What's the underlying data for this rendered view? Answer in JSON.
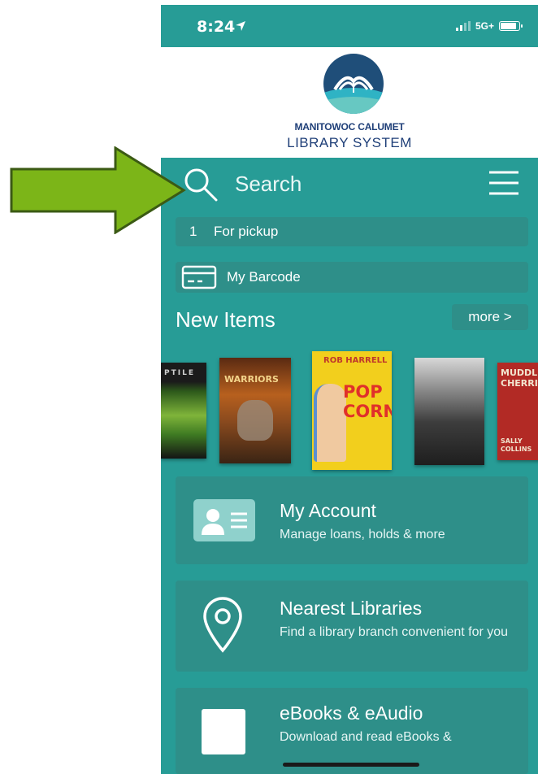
{
  "status_bar": {
    "time": "8:24",
    "network": "5G+"
  },
  "logo": {
    "line1": "MANITOWOC CALUMET",
    "line2": "LIBRARY SYSTEM"
  },
  "search": {
    "placeholder": "Search"
  },
  "pickup": {
    "count": "1",
    "label": "For pickup"
  },
  "barcode": {
    "label": "My Barcode"
  },
  "new_items": {
    "title": "New Items",
    "more_label": "more >",
    "books": [
      {
        "text": "PTILE"
      },
      {
        "text": "WARRIORS"
      },
      {
        "text": "POP CORN",
        "top_text": "ROB HARRELL"
      },
      {
        "text": ""
      },
      {
        "text": "MUDDLE CHERRI",
        "author": "SALLY COLLINS"
      }
    ]
  },
  "cards": [
    {
      "title": "My Account",
      "subtitle": "Manage loans, holds & more",
      "icon": "account-card-icon"
    },
    {
      "title": "Nearest Libraries",
      "subtitle": "Find a library branch convenient for you",
      "icon": "location-pin-icon"
    },
    {
      "title": "eBooks & eAudio",
      "subtitle": "Download and read eBooks &",
      "icon": "ebook-icon"
    }
  ],
  "colors": {
    "app_bg": "#279c96",
    "panel": "#2e8f89",
    "arrow": "#7cb518",
    "arrow_outline": "#3b5a14",
    "logo_text": "#1f3f78"
  }
}
